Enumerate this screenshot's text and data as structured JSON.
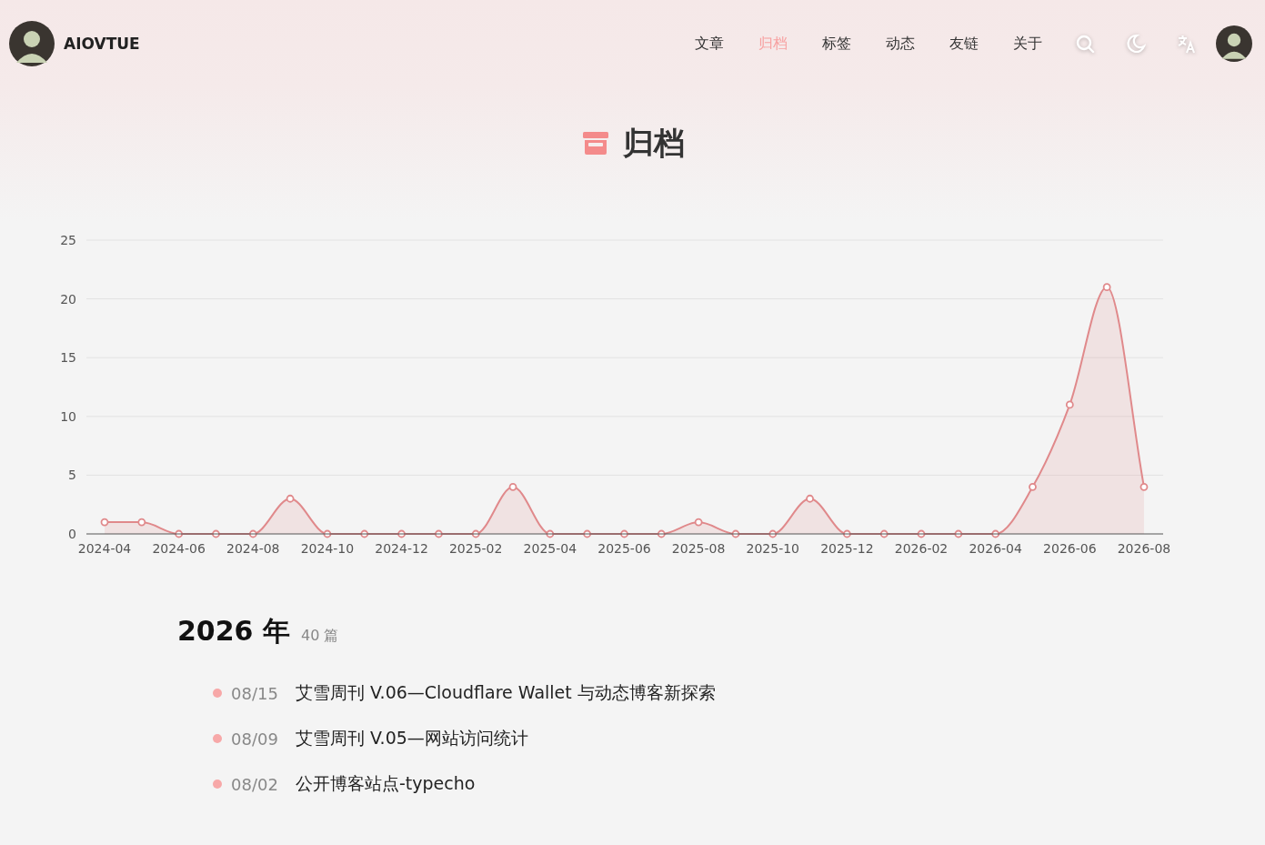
{
  "site": {
    "name": "AIOVTUE"
  },
  "nav": [
    {
      "label": "文章",
      "selected": false
    },
    {
      "label": "归档",
      "selected": true
    },
    {
      "label": "标签",
      "selected": false
    },
    {
      "label": "动态",
      "selected": false
    },
    {
      "label": "友链",
      "selected": false
    },
    {
      "label": "关于",
      "selected": false
    }
  ],
  "page_title": "归档",
  "archive_chart": {
    "chart_data": {
      "type": "area",
      "grid": true,
      "categories": [
        "2024-04",
        null,
        "2024-06",
        null,
        "2024-08",
        null,
        "2024-10",
        null,
        "2024-12",
        null,
        "2025-02",
        null,
        "2025-04",
        null,
        "2025-06",
        null,
        "2025-08",
        null,
        "2025-10",
        null,
        "2025-12",
        null,
        "2026-02",
        null,
        "2026-04",
        null,
        "2026-06",
        null,
        "2026-08"
      ],
      "series": [
        {
          "color": "#e0898b",
          "values": [
            1,
            1,
            0,
            0,
            0,
            3,
            0,
            0,
            0,
            0,
            0,
            4,
            0,
            0,
            0,
            0,
            1,
            0,
            0,
            3,
            0,
            0,
            0,
            0,
            0,
            4,
            11,
            21,
            4
          ]
        }
      ],
      "ylim": [
        0,
        25
      ],
      "yticks": [
        0,
        5,
        10,
        15,
        20,
        25
      ]
    }
  },
  "years": [
    {
      "year": "2026 年",
      "count": "40 篇",
      "posts": [
        {
          "date": "08/15",
          "title": "艾雪周刊 V.06—Cloudflare Wallet 与动态博客新探索"
        },
        {
          "date": "08/09",
          "title": "艾雪周刊 V.05—网站访问统计"
        },
        {
          "date": "08/02",
          "title": "公开博客站点-typecho"
        }
      ]
    }
  ]
}
